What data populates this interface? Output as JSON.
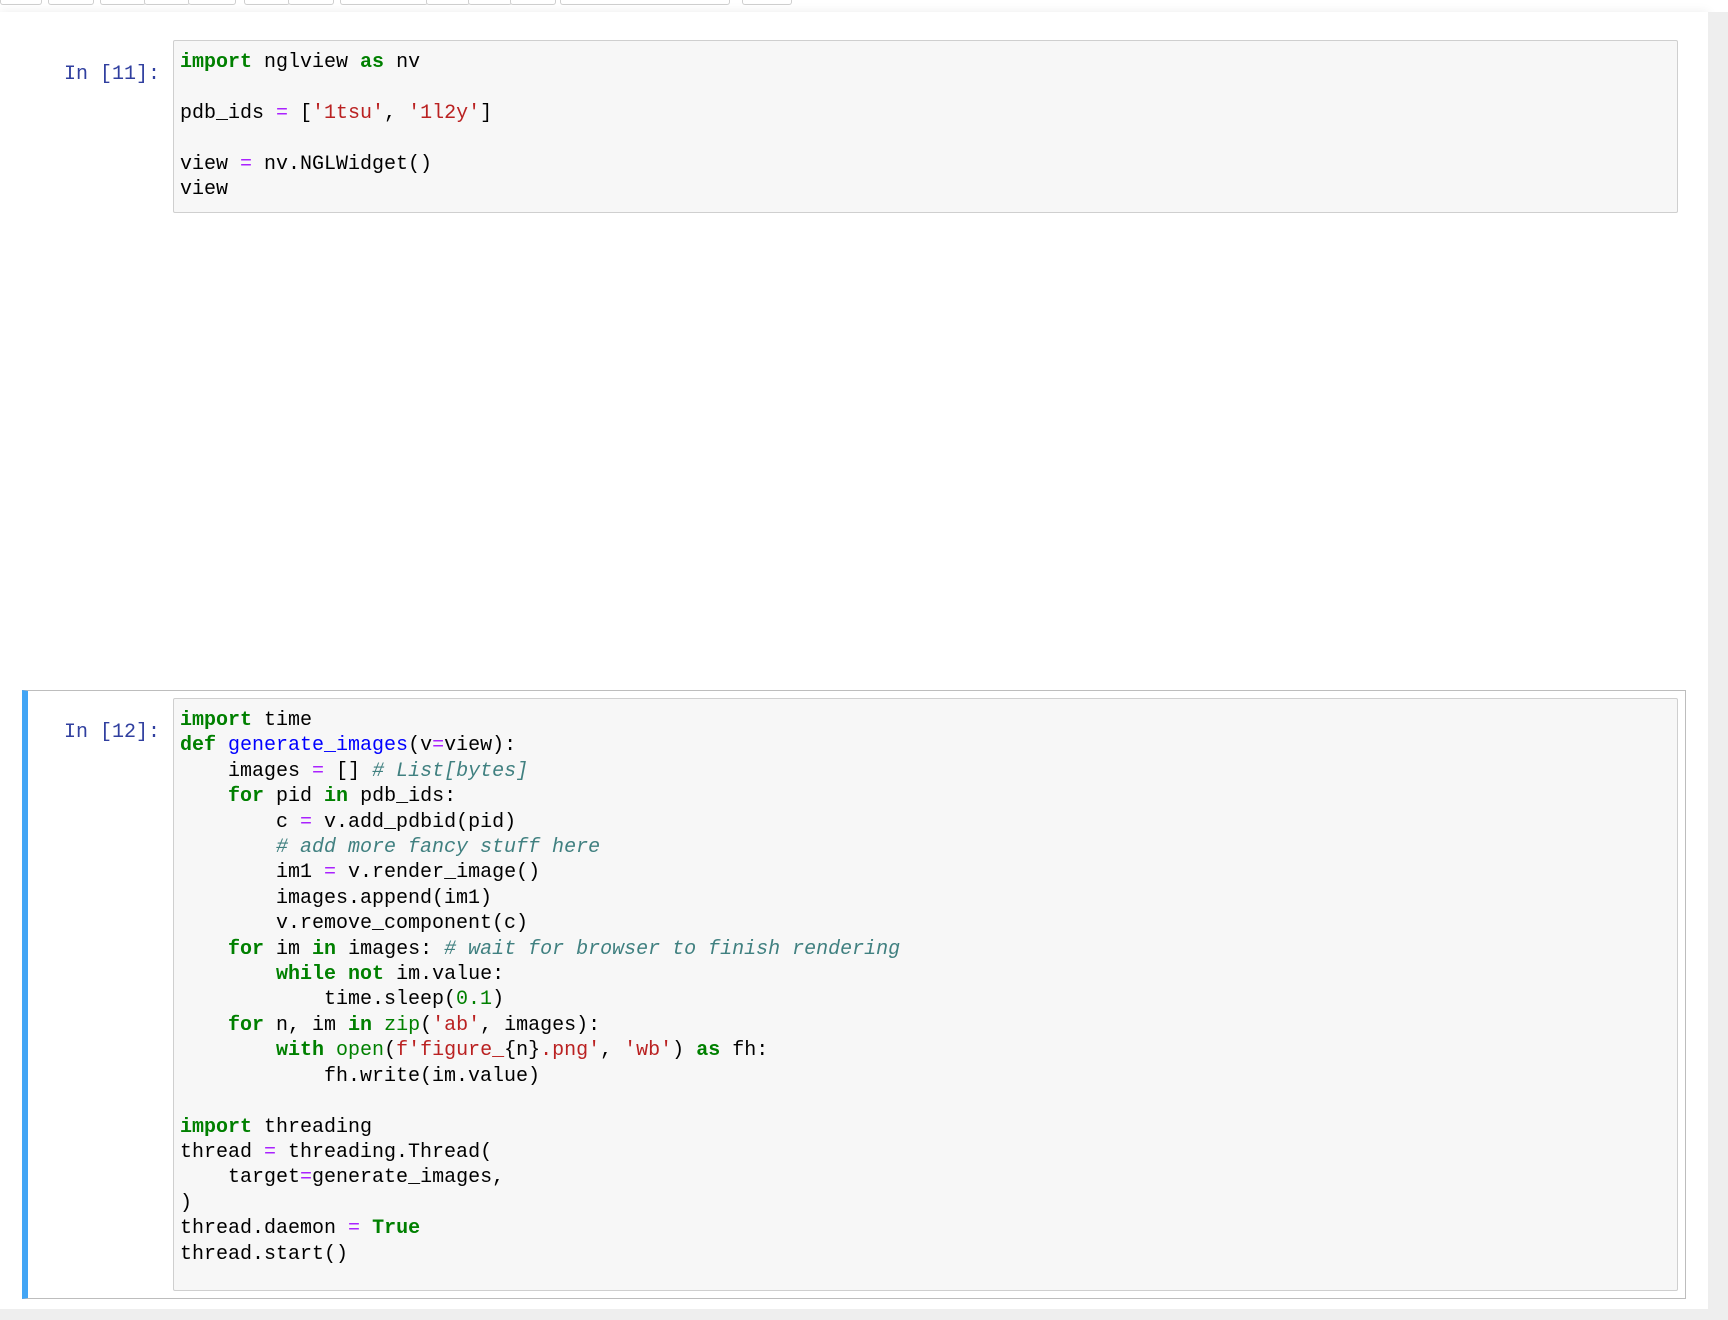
{
  "notebook": {
    "cells": [
      {
        "prompt": "In [11]:",
        "code": {
          "l1_kw1": "import",
          "l1_mod": " nglview ",
          "l1_kw2": "as",
          "l1_alias": " nv",
          "l3_name": "pdb_ids ",
          "l3_eq": "=",
          "l3_open": " [",
          "l3_s1": "'1tsu'",
          "l3_comma": ", ",
          "l3_s2": "'1l2y'",
          "l3_close": "]",
          "l5_name": "view ",
          "l5_eq": "=",
          "l5_rest": " nv.NGLWidget()",
          "l6": "view"
        }
      },
      {
        "prompt": "In [12]:",
        "code": {
          "l1_kw": "import",
          "l1_rest": " time",
          "l2_kw": "def",
          "l2_fn": "generate_images",
          "l2_p1": "(v",
          "l2_eq": "=",
          "l2_p2": "view):",
          "l3_a": "    images ",
          "l3_eq": "=",
          "l3_b": " [] ",
          "l3_cm": "# List[bytes]",
          "l4_kw1": "for",
          "l4_a": " pid ",
          "l4_kw2": "in",
          "l4_b": " pdb_ids:",
          "l5_a": "        c ",
          "l5_eq": "=",
          "l5_b": " v.add_pdbid(pid)",
          "l6_cm": "# add more fancy stuff here",
          "l7_a": "        im1 ",
          "l7_eq": "=",
          "l7_b": " v.render_image()",
          "l8": "        images.append(im1)",
          "l9": "        v.remove_component(c)",
          "l10_kw1": "for",
          "l10_a": " im ",
          "l10_kw2": "in",
          "l10_b": " images: ",
          "l10_cm": "# wait for browser to finish rendering",
          "l11_kw1": "while",
          "l11_kw2": "not",
          "l11_b": " im.value:",
          "l12_a": "            time.sleep(",
          "l12_num": "0.1",
          "l12_b": ")",
          "l13_kw1": "for",
          "l13_a": " n, im ",
          "l13_kw2": "in",
          "l13_bi": "zip",
          "l13_b": "(",
          "l13_s": "'ab'",
          "l13_c": ", images):",
          "l14_kw1": "with",
          "l14_bi": "open",
          "l14_b": "(",
          "l14_s1": "f'figure_",
          "l14_interp": "{n}",
          "l14_s2": ".png'",
          "l14_c": ", ",
          "l14_s3": "'wb'",
          "l14_d": ") ",
          "l14_kw2": "as",
          "l14_e": " fh:",
          "l15": "            fh.write(im.value)",
          "l17_kw": "import",
          "l17_rest": " threading",
          "l18_a": "thread ",
          "l18_eq": "=",
          "l18_b": " threading.Thread(",
          "l19_a": "    target",
          "l19_eq": "=",
          "l19_b": "generate_images,",
          "l20": ")",
          "l21_a": "thread.daemon ",
          "l21_eq": "=",
          "l21_kw": "True",
          "l22": "thread.start()"
        }
      }
    ]
  },
  "colors": {
    "keyword": "#008000",
    "operator": "#aa22ff",
    "string": "#ba2121",
    "function": "#0000ff",
    "comment": "#408080",
    "prompt": "#303f9f",
    "selected_cell_accent": "#42a5f5"
  }
}
